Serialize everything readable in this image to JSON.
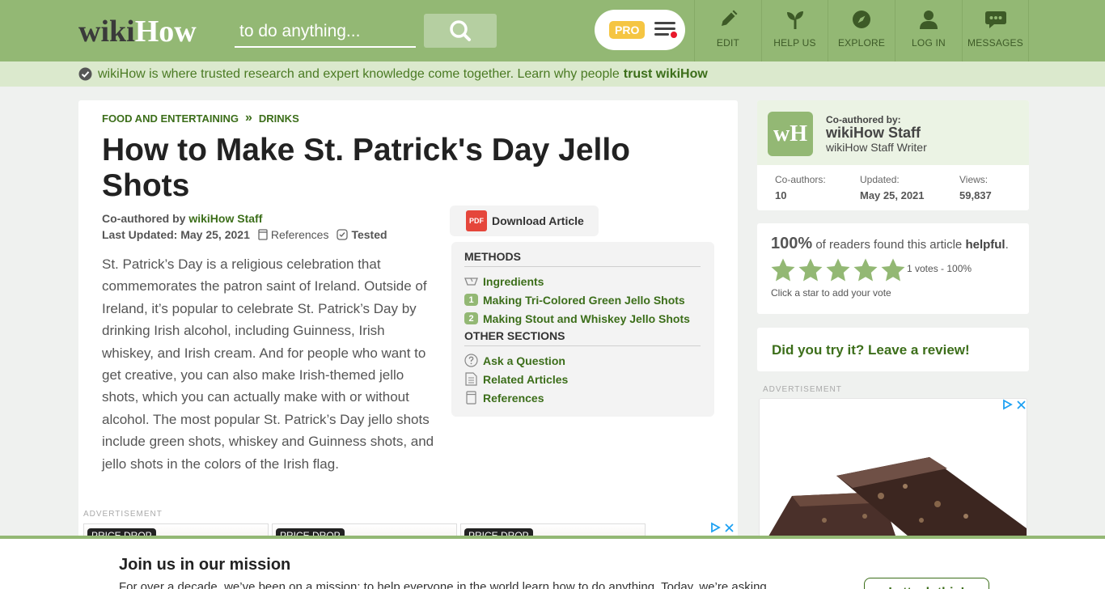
{
  "header": {
    "logo_wiki": "wiki",
    "logo_how": "How",
    "search_placeholder": "to do anything...",
    "pro_label": "PRO",
    "nav": [
      {
        "label": "EDIT",
        "icon": "pencil-icon"
      },
      {
        "label": "HELP US",
        "icon": "sprout-icon"
      },
      {
        "label": "EXPLORE",
        "icon": "compass-icon"
      },
      {
        "label": "LOG IN",
        "icon": "user-icon"
      },
      {
        "label": "MESSAGES",
        "icon": "chat-bubble-icon"
      }
    ]
  },
  "trustbar": {
    "text": "wikiHow is where trusted research and expert knowledge come together. Learn why people",
    "link": "trust wikiHow"
  },
  "article": {
    "breadcrumb": [
      "FOOD AND ENTERTAINING",
      "DRINKS"
    ],
    "breadcrumb_sep": "»",
    "title": "How to Make St. Patrick's Day Jello Shots",
    "byline_prefix": "Co-authored by",
    "byline_author": "wikiHow Staff",
    "last_updated_label": "Last Updated:",
    "last_updated": "May 25, 2021",
    "references_label": "References",
    "tested_label": "Tested",
    "download_label": "Download Article",
    "pdf_label": "PDF",
    "intro": "St. Patrick’s Day is a religious celebration that commemorates the patron saint of Ireland. Outside of Ireland, it’s popular to celebrate St. Patrick’s Day by drinking Irish alcohol, including Guinness, Irish whiskey, and Irish cream. And for people who want to get creative, you can also make Irish-themed jello shots, which you can actually make with or without alcohol. The most popular St. Patrick’s Day jello shots include green shots, whiskey and Guinness shots, and jello shots in the colors of the Irish flag."
  },
  "toc": {
    "methods_heading": "METHODS",
    "methods": [
      {
        "label": "Ingredients",
        "marker": ""
      },
      {
        "label": "Making Tri-Colored Green Jello Shots",
        "marker": "1"
      },
      {
        "label": "Making Stout and Whiskey Jello Shots",
        "marker": "2"
      }
    ],
    "other_heading": "OTHER SECTIONS",
    "other": [
      {
        "label": "Ask a Question",
        "icon": "question-icon"
      },
      {
        "label": "Related Articles",
        "icon": "document-icon"
      },
      {
        "label": "References",
        "icon": "bookmark-icon"
      }
    ]
  },
  "ads": {
    "label": "ADVERTISEMENT",
    "price_drop": "PRICE DROP"
  },
  "author_card": {
    "avatar_text": "wH",
    "coauthored_label": "Co-authored by:",
    "name": "wikiHow Staff",
    "role": "wikiHow Staff Writer",
    "stats": [
      {
        "label": "Co-authors:",
        "value": "10"
      },
      {
        "label": "Updated:",
        "value": "May 25, 2021"
      },
      {
        "label": "Views:",
        "value": "59,837"
      }
    ]
  },
  "rating": {
    "percent": "100%",
    "text_a": "of readers found this article",
    "text_b": "helpful",
    "text_end": ".",
    "stars_filled": 5,
    "votes": "1 votes - 100%",
    "hint": "Click a star to add your vote"
  },
  "review": {
    "link": "Did you try it? Leave a review!"
  },
  "mission": {
    "heading": "Join us in our mission",
    "body": "For over a decade, we’ve been on a mission: to help everyone in the world learn how to do anything. Today, we’re asking",
    "button": "I attach this!"
  },
  "colors": {
    "brand_green": "#93b874",
    "link_green": "#3c6e1a",
    "pro_yellow": "#f5c542",
    "alert_red": "#e8192c"
  }
}
